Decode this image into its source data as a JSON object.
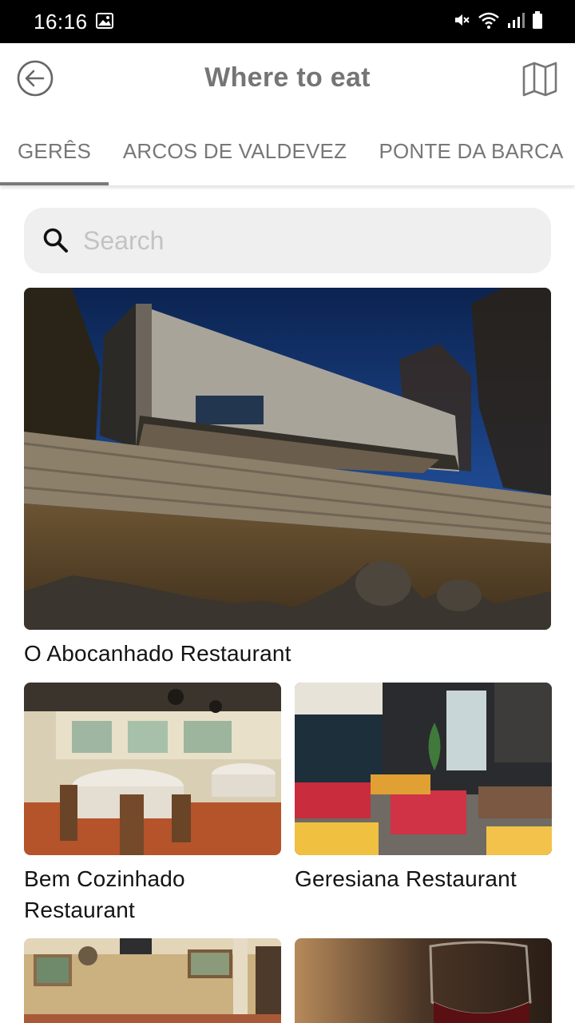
{
  "status_bar": {
    "time": "16:16",
    "icons": [
      "gallery-icon",
      "mute-icon",
      "wifi-icon",
      "signal-icon",
      "battery-icon"
    ]
  },
  "header": {
    "title": "Where to eat",
    "back_icon": "circle-arrow-left-icon",
    "map_icon": "map-icon"
  },
  "tabs": [
    {
      "label": "GERÊS",
      "active": true
    },
    {
      "label": "ARCOS DE VALDEVEZ",
      "active": false
    },
    {
      "label": "PONTE DA BARCA",
      "active": false
    }
  ],
  "search": {
    "placeholder": "Search",
    "value": "",
    "icon": "search-icon"
  },
  "restaurants": [
    {
      "name": "O Abocanhado Restaurant"
    },
    {
      "name": "Bem Cozinhado Restaurant"
    },
    {
      "name": "Geresiana Restaurant"
    },
    {
      "name": ""
    },
    {
      "name": ""
    }
  ],
  "colors": {
    "status_bar": "#000000",
    "title_text": "#757575",
    "tab_text": "#777777",
    "tab_indicator": "#7a7a7a",
    "search_bg": "#efefef",
    "placeholder": "#c3c3c3"
  }
}
